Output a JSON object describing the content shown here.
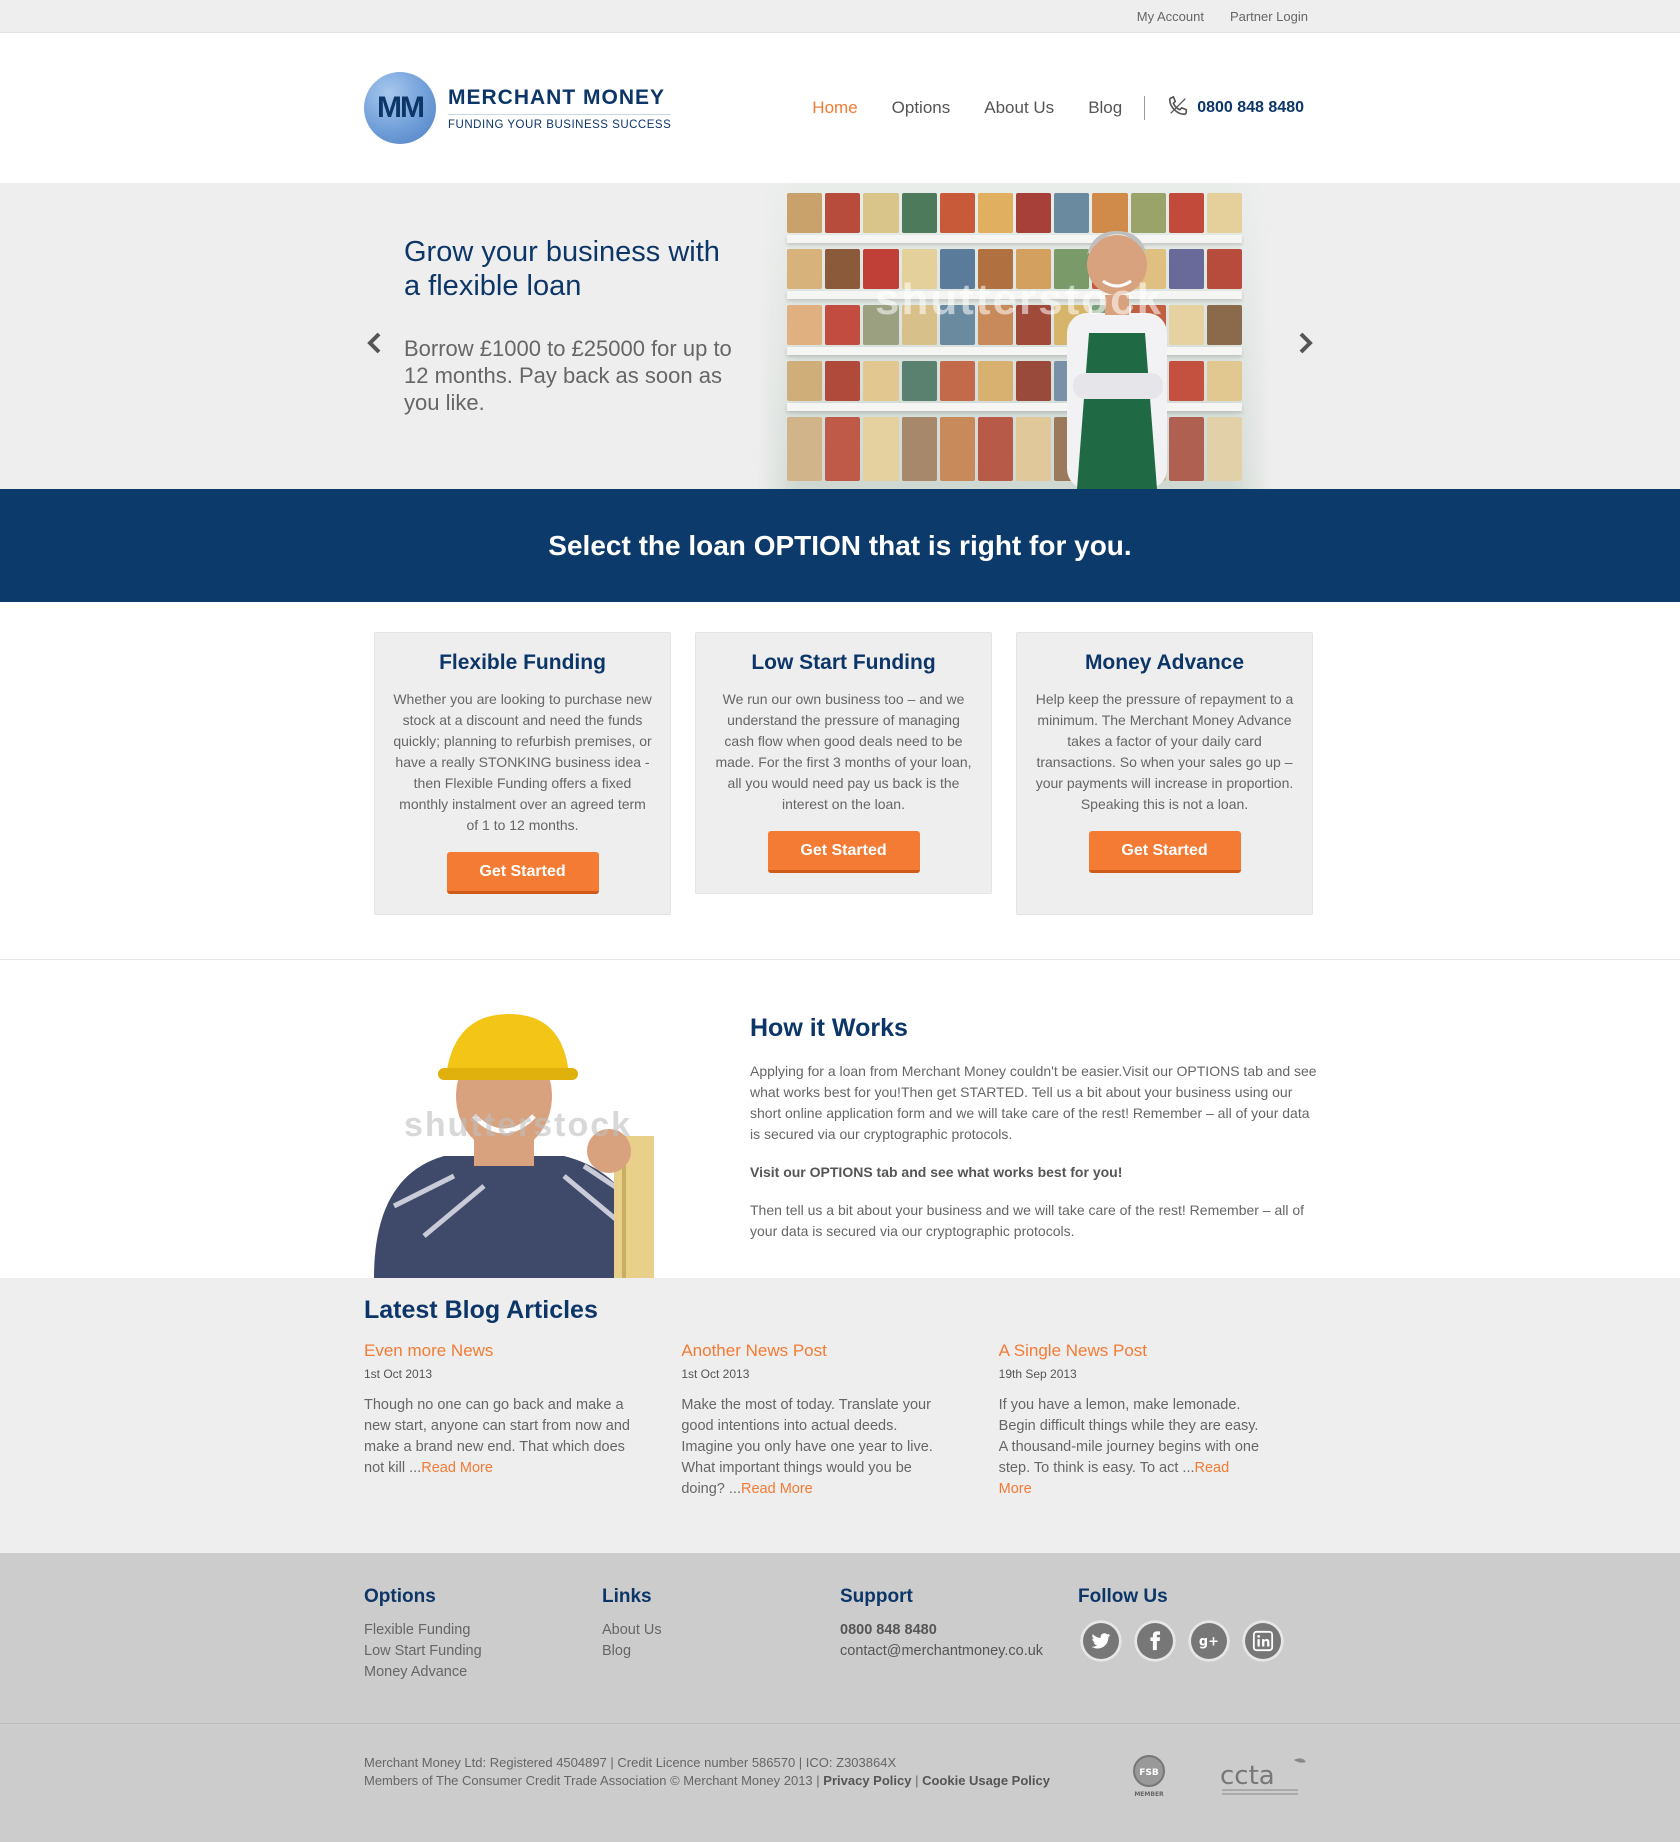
{
  "topbar": {
    "my_account": "My Account",
    "partner_login": "Partner Login"
  },
  "logo": {
    "mark": "MM",
    "name": "MERCHANT MONEY",
    "tagline": "FUNDING YOUR BUSINESS SUCCESS"
  },
  "nav": {
    "items": [
      {
        "label": "Home",
        "active": true
      },
      {
        "label": "Options"
      },
      {
        "label": "About Us"
      },
      {
        "label": "Blog"
      }
    ],
    "phone": "0800 848 8480",
    "phone_icon": "phone-icon"
  },
  "hero": {
    "title": "Grow your business with a flexible loan",
    "subtitle": "Borrow £1000 to £25000 for up to 12 months. Pay back as soon as you like.",
    "watermark": "shutterstock",
    "prev_icon": "chevron-left-icon",
    "next_icon": "chevron-right-icon"
  },
  "banner": {
    "text": "Select the loan OPTION that is right for you."
  },
  "options": [
    {
      "title": "Flexible Funding",
      "body": "Whether you are looking to purchase new stock at a discount and need the funds quickly; planning to refurbish premises, or have a really STONKING business idea - then Flexible Funding offers a fixed monthly instalment over an agreed term of 1 to 12 months.",
      "button": "Get Started"
    },
    {
      "title": "Low Start Funding",
      "body": "We run our own business too – and we understand the pressure of managing cash flow when good deals need to be made. For the first 3 months of your loan, all you would need pay us back is the interest on the loan.",
      "button": "Get Started"
    },
    {
      "title": "Money Advance",
      "body": "Help keep the pressure of repayment to a minimum. The Merchant Money Advance takes a factor of your daily card transactions. So when your sales go up – your payments will increase in proportion.",
      "body2": "Speaking this is not a loan.",
      "button": "Get Started"
    }
  ],
  "how": {
    "title": "How it Works",
    "p1": "Applying for a loan from Merchant Money couldn't be easier.Visit our OPTIONS tab and see what works best for you!Then get STARTED. Tell us a bit about your business using our short online application form and we will take care of the rest! Remember – all of your data is secured via our cryptographic protocols.",
    "p2": "Visit our OPTIONS tab and see what works best for you!",
    "p3": "Then tell us a bit about your business and we will take care of the rest! Remember – all of your data is secured via our cryptographic protocols.",
    "watermark": "shutterstock"
  },
  "blog": {
    "title": "Latest Blog Articles",
    "posts": [
      {
        "title": "Even more News",
        "date": "1st Oct 2013",
        "excerpt": "Though no one can go back and make a new start, anyone can start from now and make a brand new end. That which does not kill ...",
        "more": "Read More"
      },
      {
        "title": "Another News Post",
        "date": "1st Oct 2013",
        "excerpt": "Make the most of today. Translate your good intentions into actual deeds. Imagine you only have one year to live. What important things would you be doing? ...",
        "more": "Read More"
      },
      {
        "title": "A Single News Post",
        "date": "19th Sep 2013",
        "excerpt": "If you have a lemon, make lemonade. Begin difficult things while they are easy. A thousand-mile journey begins with one step. To think is easy. To act ...",
        "more": "Read More"
      }
    ]
  },
  "footer": {
    "options": {
      "title": "Options",
      "links": [
        "Flexible Funding",
        "Low Start Funding",
        "Money Advance"
      ]
    },
    "links": {
      "title": "Links",
      "links": [
        "About Us",
        "Blog"
      ]
    },
    "support": {
      "title": "Support",
      "phone": "0800 848 8480",
      "email": "contact@merchantmoney.co.uk"
    },
    "follow": {
      "title": "Follow Us",
      "icons": [
        "twitter-icon",
        "facebook-icon",
        "google-plus-icon",
        "linkedin-icon"
      ]
    }
  },
  "legal": {
    "line1": "Merchant Money Ltd: Registered 4504897 | Credit Licence number 586570 | ICO: Z303864X",
    "line2_prefix": "Members of The Consumer Credit Trade Association © Merchant Money 2013 |",
    "privacy": "Privacy Policy",
    "divider": "|",
    "cookie": "Cookie Usage Policy",
    "badge_fsb": "FSB",
    "badge_fsb_sub": "MEMBER",
    "badge_ccta": "ccta"
  },
  "colors": {
    "navy": "#0d3668",
    "banner": "#0b3a6b",
    "accent": "#f47b34",
    "light_bg": "#eeeeee",
    "footer_bg": "#cccccc"
  }
}
